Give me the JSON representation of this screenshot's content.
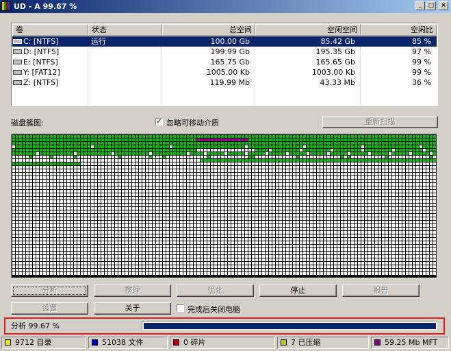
{
  "window": {
    "title": "UD - A  99.67 %",
    "buttons": {
      "minimize": "_",
      "maximize": "□",
      "close": "×"
    }
  },
  "volumes": {
    "columns": [
      "卷",
      "状态",
      "总空间",
      "空闲空间",
      "空闲比"
    ],
    "rows": [
      {
        "volume": "C: [NTFS]",
        "status": "运行",
        "total": "100.00 Gb",
        "free": "85.42 Gb",
        "ratio": "85 %",
        "selected": true
      },
      {
        "volume": "D: [NTFS]",
        "status": "",
        "total": "199.99 Gb",
        "free": "195.35 Gb",
        "ratio": "97 %"
      },
      {
        "volume": "E: [NTFS]",
        "status": "",
        "total": "165.75 Gb",
        "free": "165.65 Gb",
        "ratio": "99 %"
      },
      {
        "volume": "Y: [FAT12]",
        "status": "",
        "total": "1005.00 Kb",
        "free": "1003.00 Kb",
        "ratio": "99 %"
      },
      {
        "volume": "Z: [NTFS]",
        "status": "",
        "total": "119.99 Mb",
        "free": "43.33 Mb",
        "ratio": "36 %"
      }
    ]
  },
  "map": {
    "label": "磁盘簇图:",
    "skip_removable": {
      "label": "忽略可移动介质",
      "checked": true
    },
    "rescan_label": "重新扫描",
    "colors": {
      "used": "#00c000",
      "free": "#ffffff",
      "mft": "#a000a0",
      "grid": "#000000"
    }
  },
  "actions": {
    "analyze": "分析",
    "defrag": "整理",
    "optimize": "优化",
    "stop": "停止",
    "report": "报告",
    "settings": "设置",
    "about": "关于",
    "shutdown_when_done": {
      "label": "完成后关闭电脑",
      "checked": false
    }
  },
  "progress": {
    "label": "分析  99.67 %",
    "value": 0.9967,
    "color": "#0a246a"
  },
  "statusbar": [
    {
      "text": "9712 目录",
      "color": "#e8e800"
    },
    {
      "text": "51038 文件",
      "color": "#0000c0"
    },
    {
      "text": "0 碎片",
      "color": "#c00000"
    },
    {
      "text": "7 已压缩",
      "color": "#c8c800"
    },
    {
      "text": "59.25 Mb MFT",
      "color": "#800080"
    }
  ]
}
